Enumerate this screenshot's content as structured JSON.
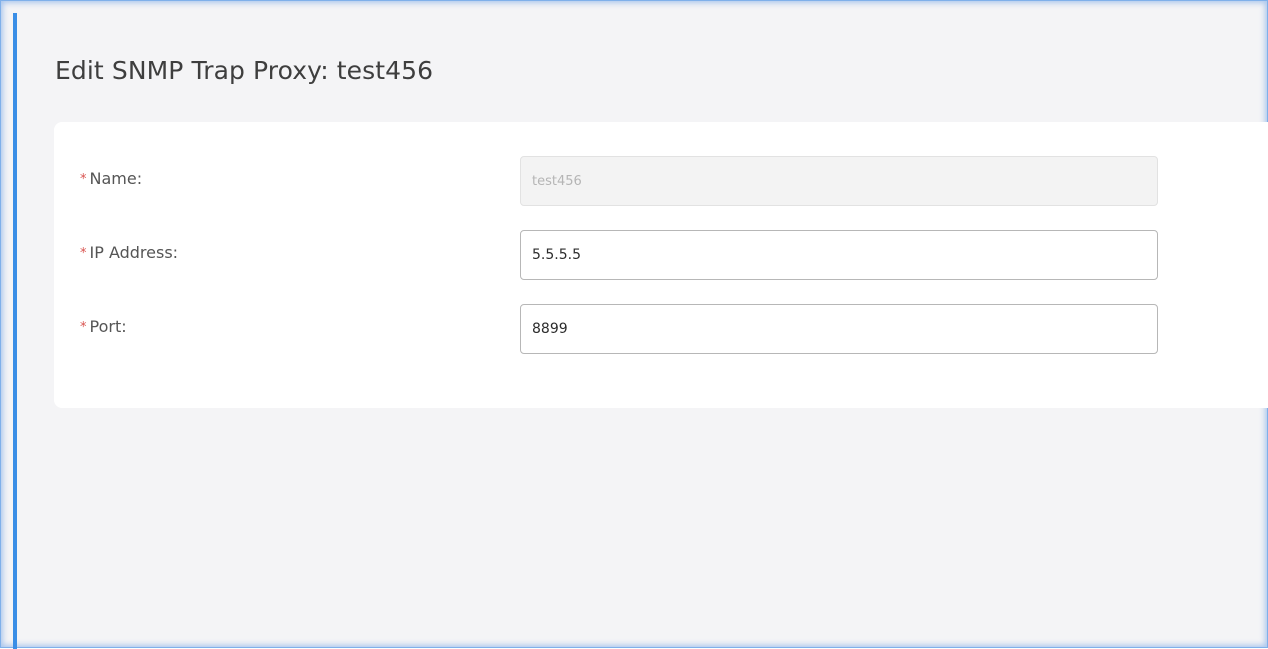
{
  "page": {
    "title": "Edit SNMP Trap Proxy: test456"
  },
  "form": {
    "required_mark": "*",
    "fields": [
      {
        "label": "Name:",
        "value": "test456",
        "disabled": true
      },
      {
        "label": "IP Address:",
        "value": "5.5.5.5",
        "disabled": false
      },
      {
        "label": "Port:",
        "value": "8899",
        "disabled": false
      }
    ]
  },
  "colors": {
    "accent_bar": "#3a8ee6",
    "required_mark": "#d9534f",
    "page_background": "#f4f4f6",
    "card_background": "#ffffff"
  }
}
